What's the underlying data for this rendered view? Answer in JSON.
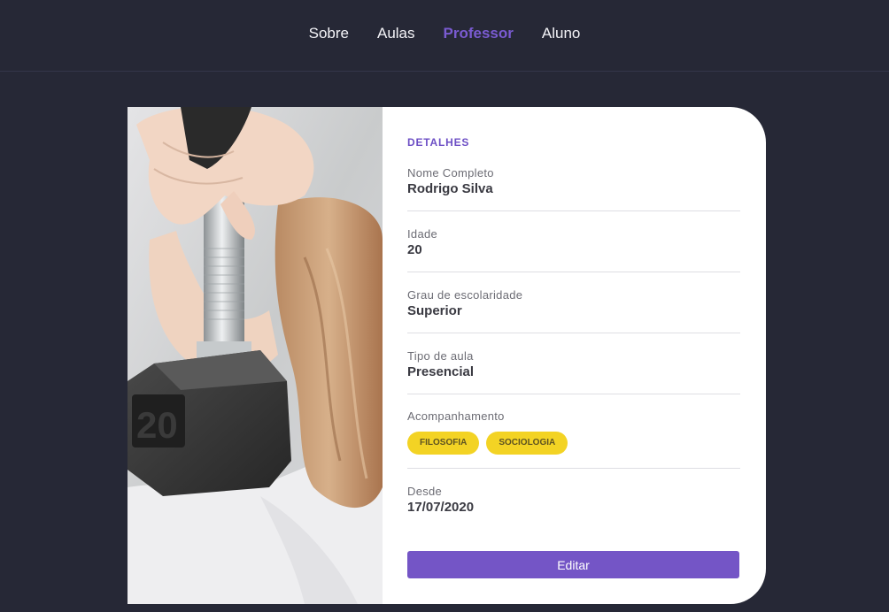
{
  "nav": {
    "items": [
      {
        "label": "Sobre",
        "active": false
      },
      {
        "label": "Aulas",
        "active": false
      },
      {
        "label": "Professor",
        "active": true
      },
      {
        "label": "Aluno",
        "active": false
      }
    ]
  },
  "photo": {
    "dumbbell_weight": "20"
  },
  "details": {
    "title": "DETALHES",
    "name_label": "Nome Completo",
    "name_value": "Rodrigo Silva",
    "age_label": "Idade",
    "age_value": "20",
    "education_label": "Grau de escolaridade",
    "education_value": "Superior",
    "class_type_label": "Tipo de aula",
    "class_type_value": "Presencial",
    "subjects_label": "Acompanhamento",
    "subjects": [
      "FILOSOFIA",
      "SOCIOLOGIA"
    ],
    "since_label": "Desde",
    "since_value": "17/07/2020"
  },
  "actions": {
    "edit_label": "Editar"
  },
  "colors": {
    "background": "#262836",
    "accent": "#7455c6",
    "tag": "#f3d324",
    "card": "#ffffff"
  }
}
